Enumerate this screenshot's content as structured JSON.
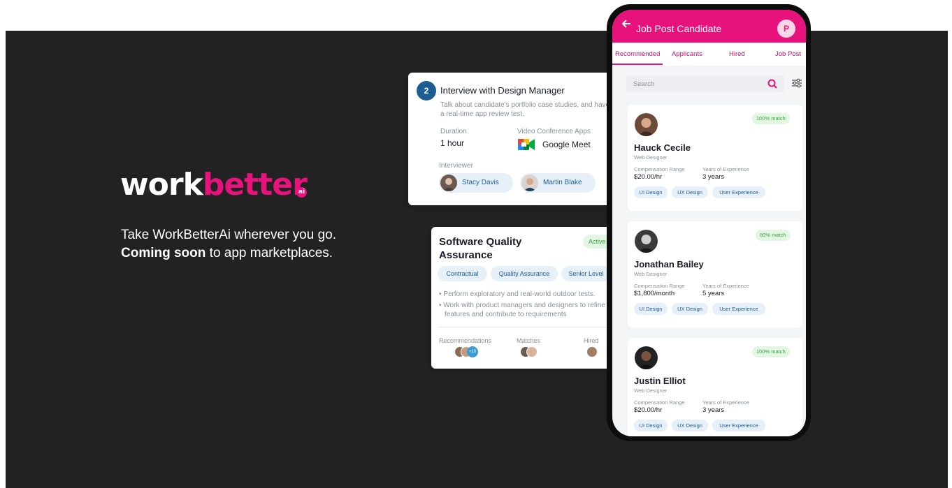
{
  "brand": {
    "logo_work": "work",
    "logo_better": "better",
    "logo_ai": "ai",
    "tagline_line1": "Take WorkBetterAi wherever you go.",
    "tagline_bold": "Coming soon",
    "tagline_rest": " to app marketplaces.",
    "accent_color": "#e8127c"
  },
  "interview_card": {
    "step": "2",
    "title": "Interview with Design Manager",
    "description": "Talk about candidate's portfolio case studies, and have a real-time app review test.",
    "duration_label": "Duration",
    "duration_value": "1 hour",
    "apps_label": "Video Conference Apps",
    "apps_value": "Google Meet",
    "interviewer_label": "Interviewer",
    "interviewers": [
      "Stacy Davis",
      "Martin Blake"
    ]
  },
  "job_card": {
    "title": "Software Quality Assurance",
    "status": "Active",
    "tags": [
      "Contractual",
      "Quality Assurance",
      "Senior Level"
    ],
    "bullets": [
      "Perform exploratory and real-world outdoor tests.",
      "Work with product managers and designers to refine features and contribute to requirements"
    ],
    "stats": {
      "recommendations_label": "Recommendations",
      "recommendations_more": "+10",
      "matches_label": "Matches",
      "hired_label": "Hired"
    }
  },
  "phone": {
    "header_title": "Job Post Candidate",
    "avatar_initial": "P",
    "tabs": [
      "Recommended",
      "Applicants",
      "Hired",
      "Job Post"
    ],
    "active_tab": "Recommended",
    "search_placeholder": "Search",
    "candidates": [
      {
        "name": "Hauck Cecile",
        "role": "Web Designer",
        "match": "100% match",
        "comp_label": "Compensation Range",
        "comp_value": "$20.00/hr",
        "exp_label": "Years of Experience",
        "exp_value": "3 years",
        "tags": [
          "UI Design",
          "UX Design",
          "User Experience"
        ]
      },
      {
        "name": "Jonathan Bailey",
        "role": "Web Designer",
        "match": "80% match",
        "comp_label": "Compensation Range",
        "comp_value": "$1,800/month",
        "exp_label": "Years of Experience",
        "exp_value": "5 years",
        "tags": [
          "UI Design",
          "UX Design",
          "User Experience"
        ]
      },
      {
        "name": "Justin Elliot",
        "role": "Web Designer",
        "match": "100% match",
        "comp_label": "Compensation Range",
        "comp_value": "$20.00/hr",
        "exp_label": "Years of Experience",
        "exp_value": "3 years",
        "tags": [
          "UI Design",
          "UX Design",
          "User Experience"
        ]
      }
    ]
  }
}
